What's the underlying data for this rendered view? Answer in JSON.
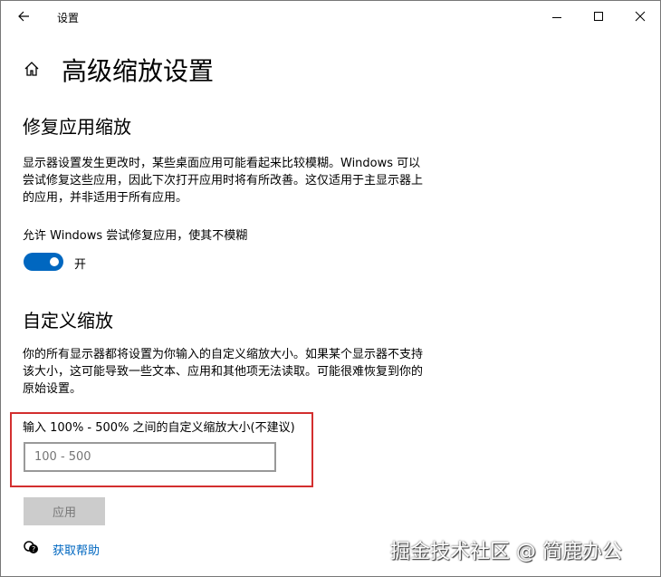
{
  "window": {
    "title": "设置"
  },
  "page": {
    "title": "高级缩放设置"
  },
  "fix": {
    "heading": "修复应用缩放",
    "description": "显示器设置发生更改时，某些桌面应用可能看起来比较模糊。Windows 可以尝试修复这些应用，因此下次打开应用时将有所改善。这仅适用于主显示器上的应用，并非适用于所有应用。",
    "toggle_label": "允许 Windows 尝试修复应用，使其不模糊",
    "toggle_state": "开",
    "toggle_on": true
  },
  "custom": {
    "heading": "自定义缩放",
    "description": "你的所有显示器都将设置为你输入的自定义缩放大小。如果某个显示器不支持该大小，这可能导致一些文本、应用和其他项无法读取。可能很难恢复到你的原始设置。",
    "input_label": "输入 100% - 500% 之间的自定义缩放大小(不建议)",
    "input_placeholder": "100 - 500",
    "input_value": "",
    "apply_label": "应用"
  },
  "help": {
    "label": "获取帮助"
  },
  "watermark": "掘金技术社区 @ 简鹿办公",
  "colors": {
    "accent": "#0067c0",
    "highlight": "#d32f2f"
  }
}
